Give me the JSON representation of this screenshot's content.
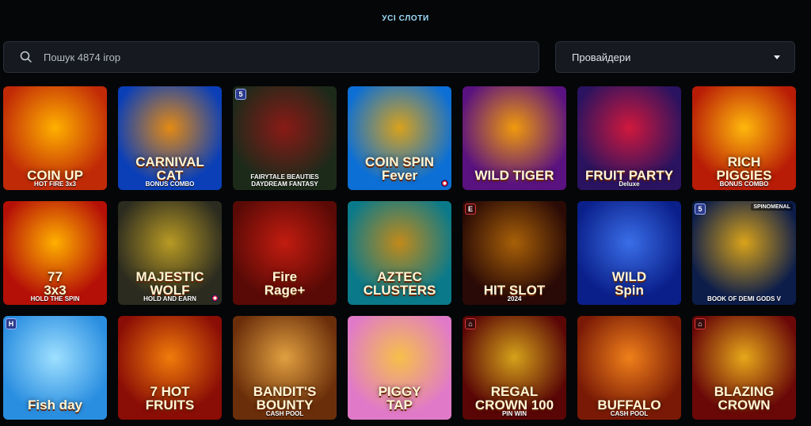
{
  "page": {
    "title": "УСІ СЛОТИ"
  },
  "search": {
    "placeholder": "Пошук 4874 ігор"
  },
  "providers": {
    "label": "Провайдери"
  },
  "games": [
    {
      "name": "COIN UP",
      "sub": "HOT FIRE 3x3",
      "bg": "#c12a07",
      "bg2": "#ffb000"
    },
    {
      "name": "CARNIVAL CAT",
      "sub": "BONUS COMBO",
      "bg": "#0a3fb8",
      "bg2": "#e48a13"
    },
    {
      "name": "",
      "sub": "FAIRYTALE BEAUTIES\nDAYDREAM FANTASY",
      "bg": "#1c2a1a",
      "bg2": "#8a1a16",
      "badge": "5"
    },
    {
      "name": "COIN SPIN\nFever",
      "sub": "",
      "bg": "#0b6fd6",
      "bg2": "#d9a21c"
    },
    {
      "name": "WILD TIGER",
      "sub": "",
      "bg": "#5a1280",
      "bg2": "#f09a0c"
    },
    {
      "name": "FRUIT PARTY",
      "sub": "Deluxe",
      "bg": "#2a1360",
      "bg2": "#d0183c"
    },
    {
      "name": "RICH\nPIGGIES",
      "sub": "BONUS COMBO",
      "bg": "#b81c06",
      "bg2": "#ffb80c"
    },
    {
      "name": "77\n3x3",
      "sub": "HOLD THE SPIN",
      "bg": "#b51007",
      "bg2": "#ffb000"
    },
    {
      "name": "MAJESTIC\nWOLF",
      "sub": "HOLD AND EARN",
      "bg": "#2b2b20",
      "bg2": "#b89a24"
    },
    {
      "name": "Fire\nRage+",
      "sub": "",
      "bg": "#5a0a06",
      "bg2": "#c21c10"
    },
    {
      "name": "AZTEC\nCLUSTERS",
      "sub": "",
      "bg": "#0a7a8a",
      "bg2": "#c28a1a"
    },
    {
      "name": "HIT SLOT",
      "sub": "2024",
      "bg": "#2a0a06",
      "bg2": "#a86008",
      "badge": "E",
      "badgeRed": true
    },
    {
      "name": "WILD\nSpin",
      "sub": "",
      "bg": "#0a1f8a",
      "bg2": "#3a6ee8"
    },
    {
      "name": "",
      "sub": "BOOK OF DEMI GODS V",
      "bg": "#0c1d4a",
      "bg2": "#d9a31a",
      "badge": "5",
      "prov": "SPINOMENAL"
    },
    {
      "name": "Fish day",
      "sub": "",
      "bg": "#2a8ee0",
      "bg2": "#9ee0ff",
      "badge": "H"
    },
    {
      "name": "7 HOT\nFRUITS",
      "sub": "",
      "bg": "#8a0d06",
      "bg2": "#f07c0a"
    },
    {
      "name": "BANDIT'S\nBOUNTY",
      "sub": "CASH POOL",
      "bg": "#6b2e0a",
      "bg2": "#e0a040"
    },
    {
      "name": "PIGGY\nTAP",
      "sub": "",
      "bg": "#e07ac8",
      "bg2": "#f6c04a"
    },
    {
      "name": "REGAL\nCROWN 100",
      "sub": "PIN WIN",
      "bg": "#5a0606",
      "bg2": "#d4a21a",
      "badge": "⌂",
      "badgeRed": true
    },
    {
      "name": "BUFFALO",
      "sub": "CASH POOL",
      "bg": "#7a1a06",
      "bg2": "#f0801a"
    },
    {
      "name": "BLAZING\nCROWN",
      "sub": "",
      "bg": "#6a0808",
      "bg2": "#e6a81a",
      "badge": "⌂",
      "badgeRed": true
    }
  ]
}
